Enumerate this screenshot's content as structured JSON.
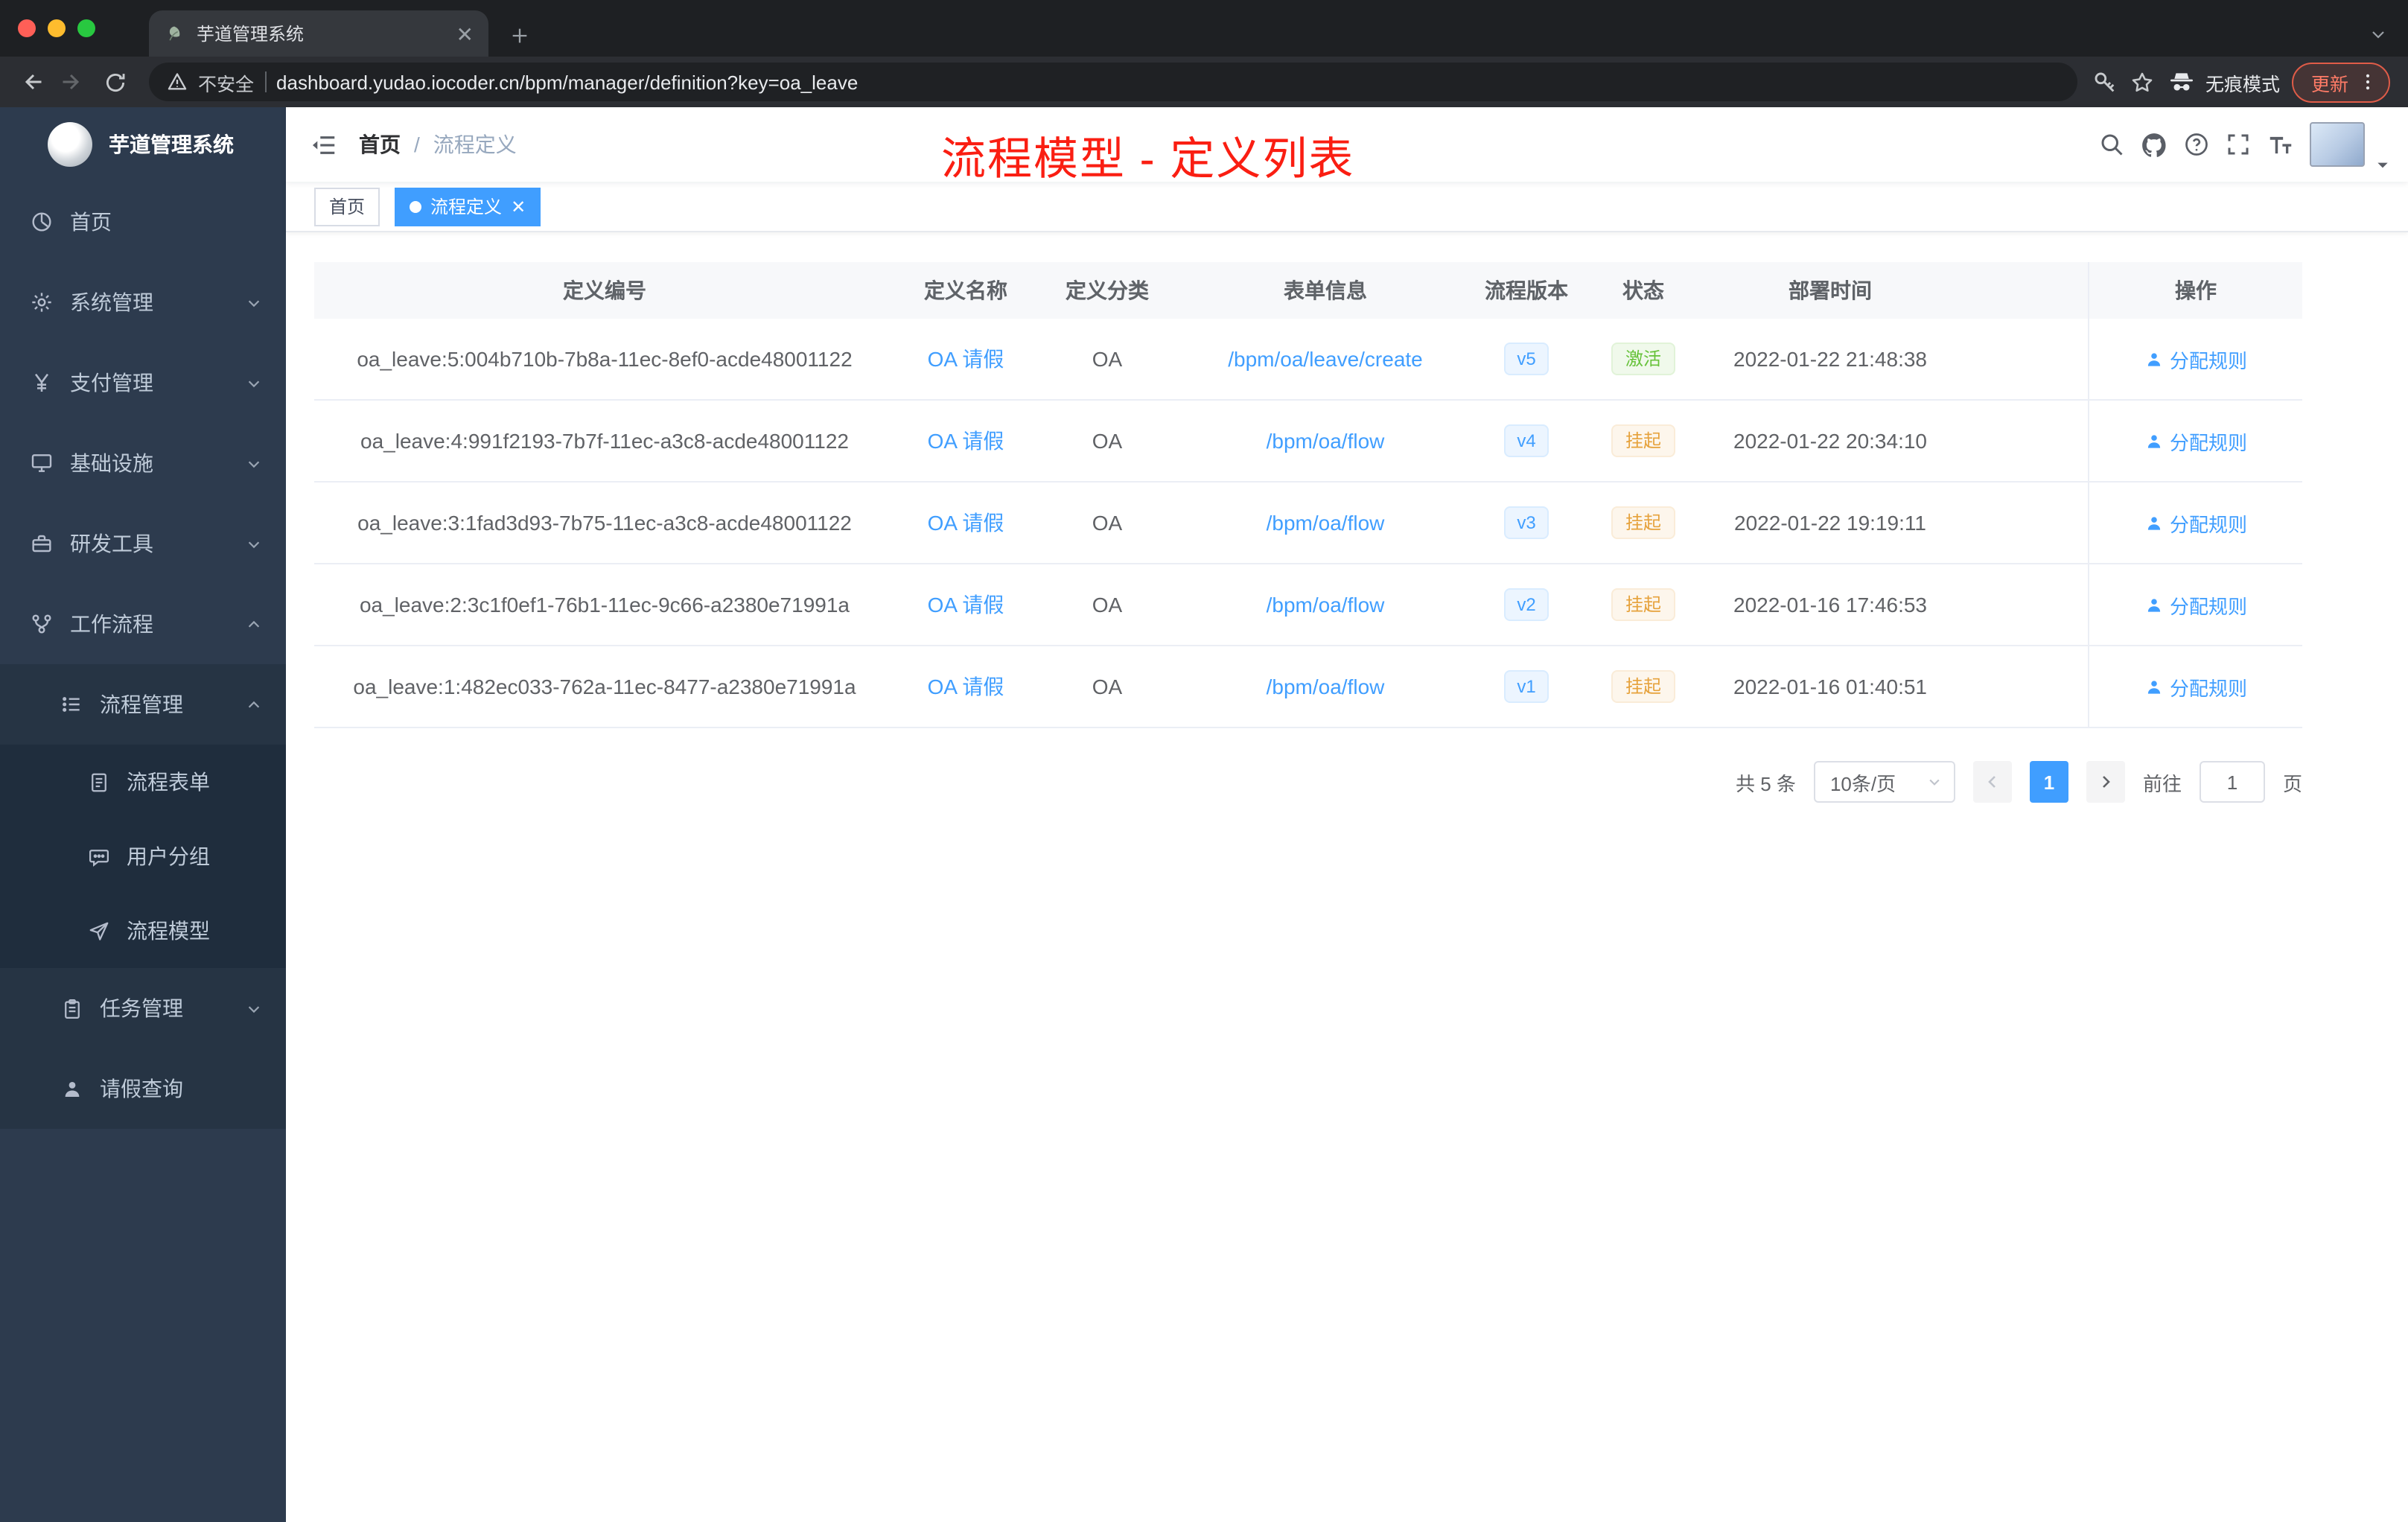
{
  "colors": {
    "primary": "#409eff",
    "annotation_red": "#fa1e12",
    "status_active": "#67c23a",
    "status_suspended": "#e6a23c"
  },
  "browser": {
    "tab_title": "芋道管理系统",
    "security_label": "不安全",
    "url": "dashboard.yudao.iocoder.cn/bpm/manager/definition?key=oa_leave",
    "incognito_label": "无痕模式",
    "update_label": "更新"
  },
  "sidebar": {
    "logo_title": "芋道管理系统",
    "menu": [
      {
        "label": "首页"
      },
      {
        "label": "系统管理"
      },
      {
        "label": "支付管理"
      },
      {
        "label": "基础设施"
      },
      {
        "label": "研发工具"
      },
      {
        "label": "工作流程"
      },
      {
        "label": "流程管理"
      },
      {
        "label": "流程表单"
      },
      {
        "label": "用户分组"
      },
      {
        "label": "流程模型"
      },
      {
        "label": "任务管理"
      },
      {
        "label": "请假查询"
      }
    ]
  },
  "navbar": {
    "breadcrumb": [
      "首页",
      "流程定义"
    ],
    "breadcrumb_separator": "/",
    "annotation": "流程模型 - 定义列表"
  },
  "tags": [
    {
      "label": "首页",
      "active": false
    },
    {
      "label": "流程定义",
      "active": true
    }
  ],
  "table": {
    "headers": [
      "定义编号",
      "定义名称",
      "定义分类",
      "表单信息",
      "流程版本",
      "状态",
      "部署时间",
      "操作"
    ],
    "rows": [
      {
        "id": "oa_leave:5:004b710b-7b8a-11ec-8ef0-acde48001122",
        "name": "OA 请假",
        "category": "OA",
        "form": "/bpm/oa/leave/create",
        "version": "v5",
        "status": "激活",
        "status_type": "active",
        "deploy_time": "2022-01-22 21:48:38",
        "action": "分配规则"
      },
      {
        "id": "oa_leave:4:991f2193-7b7f-11ec-a3c8-acde48001122",
        "name": "OA 请假",
        "category": "OA",
        "form": "/bpm/oa/flow",
        "version": "v4",
        "status": "挂起",
        "status_type": "suspended",
        "deploy_time": "2022-01-22 20:34:10",
        "action": "分配规则"
      },
      {
        "id": "oa_leave:3:1fad3d93-7b75-11ec-a3c8-acde48001122",
        "name": "OA 请假",
        "category": "OA",
        "form": "/bpm/oa/flow",
        "version": "v3",
        "status": "挂起",
        "status_type": "suspended",
        "deploy_time": "2022-01-22 19:19:11",
        "action": "分配规则"
      },
      {
        "id": "oa_leave:2:3c1f0ef1-76b1-11ec-9c66-a2380e71991a",
        "name": "OA 请假",
        "category": "OA",
        "form": "/bpm/oa/flow",
        "version": "v2",
        "status": "挂起",
        "status_type": "suspended",
        "deploy_time": "2022-01-16 17:46:53",
        "action": "分配规则"
      },
      {
        "id": "oa_leave:1:482ec033-762a-11ec-8477-a2380e71991a",
        "name": "OA 请假",
        "category": "OA",
        "form": "/bpm/oa/flow",
        "version": "v1",
        "status": "挂起",
        "status_type": "suspended",
        "deploy_time": "2022-01-16 01:40:51",
        "action": "分配规则"
      }
    ]
  },
  "pagination": {
    "total": "共 5 条",
    "page_size": "10条/页",
    "current_page": "1",
    "goto_label": "前往",
    "goto_value": "1",
    "unit": "页"
  }
}
